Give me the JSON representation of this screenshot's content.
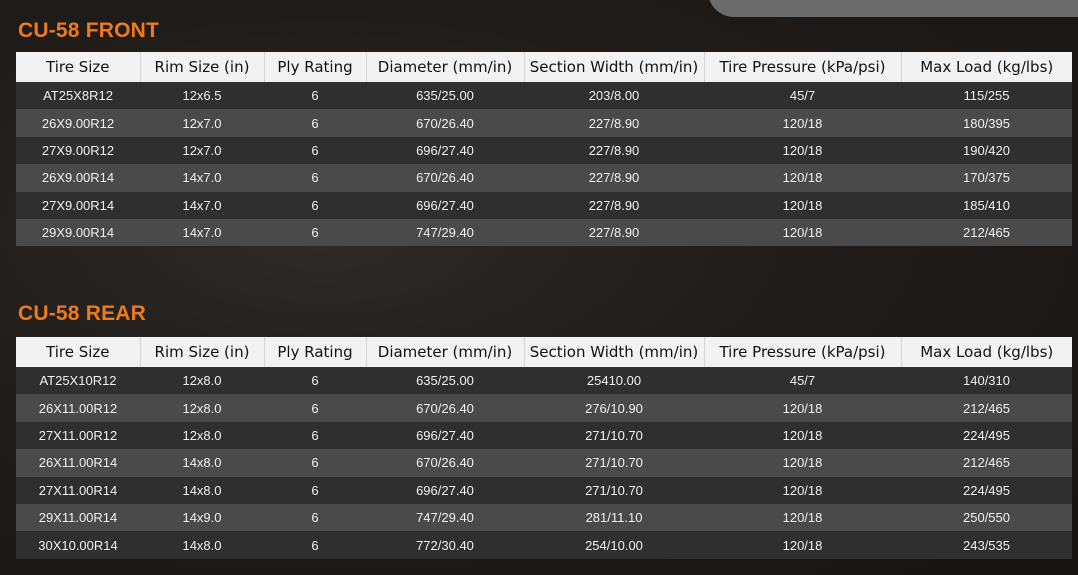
{
  "front": {
    "title": "CU-58 FRONT",
    "headers": [
      "Tire Size",
      "Rim Size (in)",
      "Ply Rating",
      "Diameter (mm/in)",
      "Section Width (mm/in)",
      "Tire Pressure (kPa/psi)",
      "Max Load (kg/lbs)"
    ],
    "rows": [
      [
        "AT25X8R12",
        "12x6.5",
        "6",
        "635/25.00",
        "203/8.00",
        "45/7",
        "115/255"
      ],
      [
        "26X9.00R12",
        "12x7.0",
        "6",
        "670/26.40",
        "227/8.90",
        "120/18",
        "180/395"
      ],
      [
        "27X9.00R12",
        "12x7.0",
        "6",
        "696/27.40",
        "227/8.90",
        "120/18",
        "190/420"
      ],
      [
        "26X9.00R14",
        "14x7.0",
        "6",
        "670/26.40",
        "227/8.90",
        "120/18",
        "170/375"
      ],
      [
        "27X9.00R14",
        "14x7.0",
        "6",
        "696/27.40",
        "227/8.90",
        "120/18",
        "185/410"
      ],
      [
        "29X9.00R14",
        "14x7.0",
        "6",
        "747/29.40",
        "227/8.90",
        "120/18",
        "212/465"
      ]
    ]
  },
  "rear": {
    "title": "CU-58 REAR",
    "headers": [
      "Tire Size",
      "Rim Size (in)",
      "Ply Rating",
      "Diameter (mm/in)",
      "Section Width (mm/in)",
      "Tire Pressure (kPa/psi)",
      "Max Load (kg/lbs)"
    ],
    "rows": [
      [
        "AT25X10R12",
        "12x8.0",
        "6",
        "635/25.00",
        "25410.00",
        "45/7",
        "140/310"
      ],
      [
        "26X11.00R12",
        "12x8.0",
        "6",
        "670/26.40",
        "276/10.90",
        "120/18",
        "212/465"
      ],
      [
        "27X11.00R12",
        "12x8.0",
        "6",
        "696/27.40",
        "271/10.70",
        "120/18",
        "224/495"
      ],
      [
        "26X11.00R14",
        "14x8.0",
        "6",
        "670/26.40",
        "271/10.70",
        "120/18",
        "212/465"
      ],
      [
        "27X11.00R14",
        "14x8.0",
        "6",
        "696/27.40",
        "271/10.70",
        "120/18",
        "224/495"
      ],
      [
        "29X11.00R14",
        "14x9.0",
        "6",
        "747/29.40",
        "281/11.10",
        "120/18",
        "250/550"
      ],
      [
        "30X10.00R14",
        "14x8.0",
        "6",
        "772/30.40",
        "254/10.00",
        "120/18",
        "243/535"
      ]
    ]
  },
  "colors": {
    "accent": "#ee7a1c",
    "header_bg": "#f2f2f2",
    "row_dark": "#2f2f2f",
    "row_light": "#4a4a4a"
  }
}
